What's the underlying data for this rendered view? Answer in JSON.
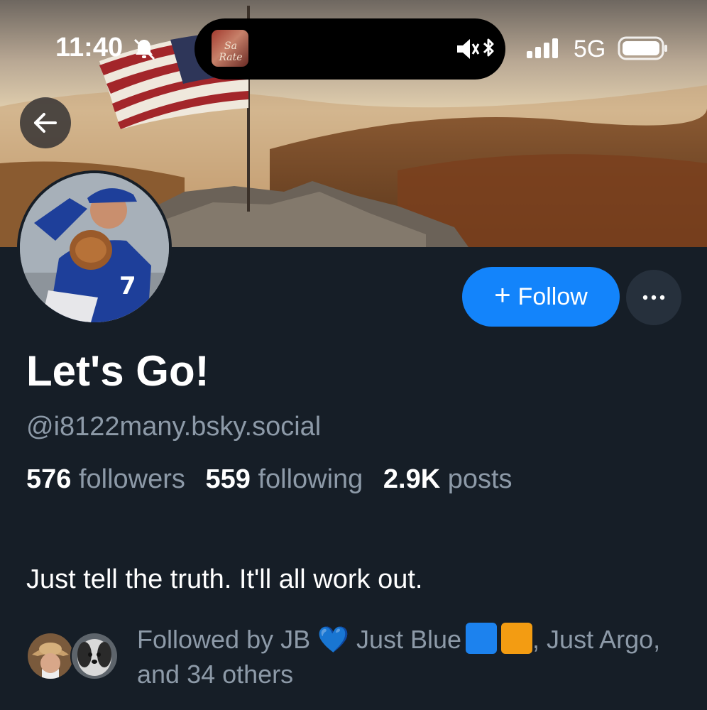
{
  "status_bar": {
    "time": "11:40",
    "network": "5G",
    "icons": [
      "bell-slash-icon",
      "bluetooth-icon",
      "speaker-muted-icon",
      "signal-icon",
      "battery-icon"
    ]
  },
  "now_playing": {
    "album_text": "Sa Rate"
  },
  "header": {
    "back_icon": "arrow-left-icon"
  },
  "profile": {
    "display_name": "Let's Go!",
    "handle": "@i8122many.bsky.social",
    "follow_label": "Follow",
    "follow_icon": "+",
    "more_icon": "···",
    "stats": {
      "followers_count": "576",
      "followers_label": "followers",
      "following_count": "559",
      "following_label": "following",
      "posts_count": "2.9K",
      "posts_label": "posts"
    },
    "bio": "Just tell the truth. It'll all work out.",
    "followed_by": {
      "prefix": "Followed by JB",
      "heart": "💙",
      "middle": "Just Blue",
      "suffix": ", Just Argo, and 34 others"
    }
  },
  "colors": {
    "background": "#161e27",
    "accent": "#1384fb",
    "muted_text": "#8d9aa8",
    "more_button_bg": "#26303c"
  }
}
